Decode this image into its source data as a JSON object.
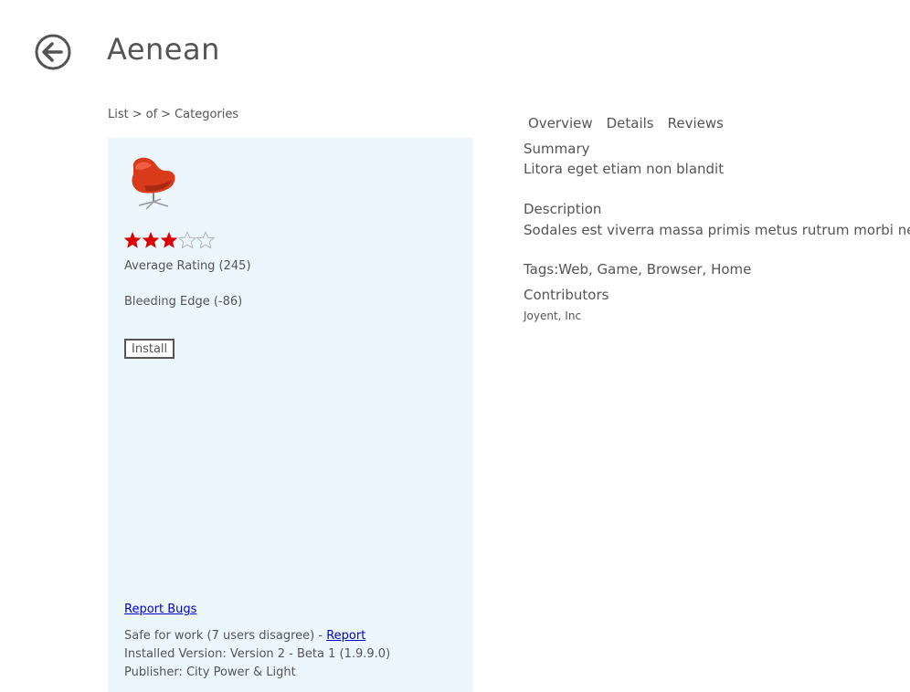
{
  "header": {
    "title": "Aenean",
    "back_icon": "back-arrow-icon"
  },
  "breadcrumb": {
    "items": [
      "List",
      "of",
      "Categories"
    ],
    "separator": ">"
  },
  "product": {
    "icon": "red-swan-chair-icon",
    "rating": {
      "filled": 3,
      "total": 5
    },
    "average_rating_label": "Average Rating (245)",
    "bleeding_edge_label": "Bleeding Edge (-86)",
    "install_label": "Install",
    "report_bugs_label": "Report Bugs",
    "safe_for_work_text": "Safe for work (7 users disagree) - ",
    "report_link_label": "Report",
    "installed_version_text": "Installed Version: Version 2 - Beta 1 (1.9.9.0)",
    "publisher_text": "Publisher: City Power & Light"
  },
  "tabs": [
    "Overview",
    "Details",
    "Reviews"
  ],
  "details": {
    "summary_heading": "Summary",
    "summary_text": "Litora eget etiam non blandit",
    "description_heading": "Description",
    "description_text": "Sodales est viverra massa primis metus rutrum morbi neque",
    "tags_label": "Tags: ",
    "tags": [
      "Web",
      "Game",
      "Browser",
      "Home"
    ],
    "contributors_heading": "Contributors",
    "contributors_text": "Joyent, Inc"
  },
  "colors": {
    "panel_bg": "#ecf6fd",
    "star_filled": "#dd0000",
    "link": "#0000cc",
    "text": "#555555"
  }
}
